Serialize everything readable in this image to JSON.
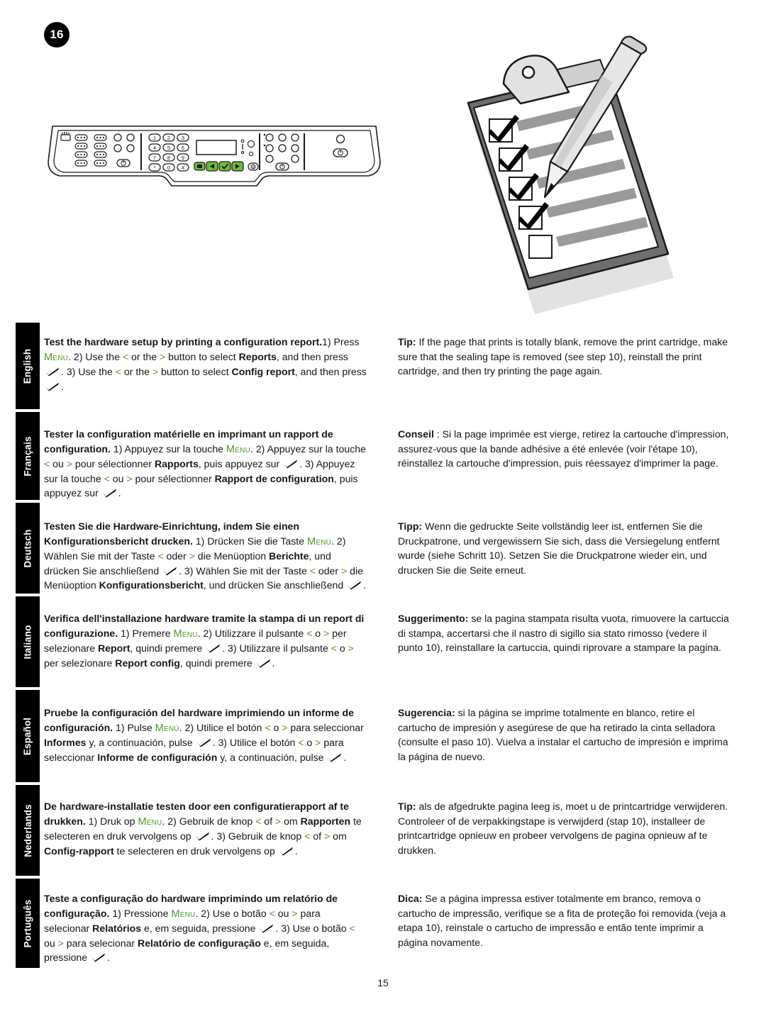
{
  "step": {
    "number": "16"
  },
  "page": {
    "number": "15"
  },
  "illustration": {
    "control_panel_name": "printer-control-panel",
    "clipboard_name": "clipboard-checklist-pencil",
    "clipboard_checked_rows": 4,
    "clipboard_unchecked_rows": 1,
    "keypad_digits": [
      "1",
      "2",
      "3",
      "4",
      "5",
      "6",
      "7",
      "8",
      "9",
      "*",
      "0",
      "#"
    ],
    "green_button_labels": [
      "menu",
      "left-arrow",
      "check",
      "right-arrow"
    ]
  },
  "languages": [
    {
      "tab": "English",
      "left": {
        "heading": "Test the hardware setup by printing a configuration report.",
        "body_1": "1) Press ",
        "menu": "Menu",
        "body_2": ". 2) Use the ",
        "lt": "<",
        "body_3": " or the ",
        "gt": ">",
        "body_4": " button to select ",
        "bold_1": "Reports",
        "body_5": ", and then press ",
        "body_6": ". 3) Use the ",
        "body_7": " or the ",
        "body_8": " button to select ",
        "bold_2": "Config report",
        "body_9": ", and then press ",
        "body_10": "."
      },
      "right": {
        "label": "Tip:",
        "text": " If the page that prints is totally blank, remove the print cartridge, make sure that the sealing tape is removed (see step 10), reinstall the print cartridge, and then try printing the page again."
      }
    },
    {
      "tab": "Français",
      "left": {
        "heading": "Tester la configuration matérielle en imprimant un rapport de configuration.",
        "body_1": "  1) Appuyez sur la touche ",
        "menu": "Menu",
        "body_2": ". 2) Appuyez sur la touche ",
        "lt": "<",
        "body_3": " ou ",
        "gt": ">",
        "body_4": " pour sélectionner ",
        "bold_1": "Rapports",
        "body_5": ", puis appuyez sur ",
        "body_6": ". 3) Appuyez sur la touche ",
        "body_7": " ou ",
        "body_8": " pour sélectionner ",
        "bold_2": "Rapport de configuration",
        "body_9": ", puis appuyez sur ",
        "body_10": "."
      },
      "right": {
        "label": "Conseil",
        "text": " : Si la page imprimée est vierge, retirez la cartouche d'impression, assurez-vous que la bande adhésive a été enlevée (voir l'étape 10), réinstallez la cartouche d'impression, puis réessayez d'imprimer la page."
      }
    },
    {
      "tab": "Deutsch",
      "left": {
        "heading": "Testen Sie die Hardware-Einrichtung, indem Sie einen Konfigurationsbericht drucken.",
        "body_1": "  1) Drücken Sie die Taste ",
        "menu": "Menü",
        "body_2": ". 2) Wählen Sie mit der Taste ",
        "lt": "<",
        "body_3": " oder ",
        "gt": ">",
        "body_4": " die Menüoption ",
        "bold_1": "Berichte",
        "body_5": ", und drücken Sie anschließend ",
        "body_6": ". 3) Wählen Sie mit der Taste ",
        "body_7": " oder ",
        "body_8": " die Menüoption ",
        "bold_2": "Konfigurationsbericht",
        "body_9": ", und drücken Sie anschließend ",
        "body_10": "."
      },
      "right": {
        "label": "Tipp:",
        "text": " Wenn die gedruckte Seite vollständig leer ist, entfernen Sie die Druckpatrone, und vergewissern Sie sich, dass die Versiegelung entfernt wurde (siehe Schritt 10). Setzen Sie die Druckpatrone wieder ein, und drucken Sie die Seite erneut."
      }
    },
    {
      "tab": "Italiano",
      "left": {
        "heading": "Verifica dell'installazione hardware tramite la stampa di un report di configurazione.",
        "body_1": "  1) Premere ",
        "menu": "Menu",
        "body_2": ". 2) Utilizzare il pulsante ",
        "lt": "<",
        "body_3": " o ",
        "gt": ">",
        "body_4": " per selezionare ",
        "bold_1": "Report",
        "body_5": ", quindi premere ",
        "body_6": ". 3) Utilizzare il pulsante ",
        "body_7": " o ",
        "body_8": " per selezionare ",
        "bold_2": "Report config",
        "body_9": ", quindi premere ",
        "body_10": "."
      },
      "right": {
        "label": "Suggerimento:",
        "text": " se la pagina stampata risulta vuota, rimuovere la cartuccia di stampa, accertarsi che il nastro di sigillo sia stato rimosso (vedere il punto 10), reinstallare la cartuccia, quindi riprovare a stampare la pagina."
      }
    },
    {
      "tab": "Español",
      "left": {
        "heading": "Pruebe la configuración del hardware imprimiendo un informe de configuración.",
        "body_1": "  1) Pulse ",
        "menu": "Menú",
        "body_2": ". 2) Utilice el botón ",
        "lt": "<",
        "body_3": " o ",
        "gt": ">",
        "body_4": " para seleccionar ",
        "bold_1": "Informes",
        "body_5": " y, a continuación, pulse ",
        "body_6": ". 3) Utilice el botón ",
        "body_7": " o ",
        "body_8": " para seleccionar ",
        "bold_2": "Informe de configuración",
        "body_9": " y, a continuación, pulse ",
        "body_10": "."
      },
      "right": {
        "label": "Sugerencia:",
        "text": " si la página se imprime totalmente en blanco, retire el cartucho de impresión y asegúrese de que ha retirado la cinta selladora (consulte el paso 10). Vuelva a instalar el cartucho de impresión e imprima la página de nuevo."
      }
    },
    {
      "tab": "Nederlands",
      "left": {
        "heading": "De hardware-installatie testen door een configuratierapport af te drukken.",
        "body_1": "  1) Druk op ",
        "menu": "Menu",
        "body_2": ". 2) Gebruik de knop ",
        "lt": "<",
        "body_3": " of ",
        "gt": ">",
        "body_4": " om ",
        "bold_1": "Rapporten",
        "body_5": " te selecteren en druk vervolgens op ",
        "body_6": ". 3) Gebruik de knop ",
        "body_7": " of ",
        "body_8": " om ",
        "bold_2": "Config-rapport",
        "body_9": " te selecteren en druk vervolgens op ",
        "body_10": "."
      },
      "right": {
        "label": "Tip:",
        "text": " als de afgedrukte pagina leeg is, moet u de printcartridge verwijderen. Controleer of de verpakkingstape is verwijderd (stap 10), installeer de printcartridge opnieuw en probeer vervolgens de pagina opnieuw af te drukken."
      }
    },
    {
      "tab": "Português",
      "left": {
        "heading": "Teste a configuração do hardware imprimindo um relatório de configuração.",
        "body_1": "  1) Pressione ",
        "menu": "Menu",
        "body_2": ". 2) Use o botão ",
        "lt": "<",
        "body_3": " ou ",
        "gt": ">",
        "body_4": " para selecionar ",
        "bold_1": "Relatórios",
        "body_5": " e, em seguida, pressione ",
        "body_6": ". 3) Use o botão ",
        "body_7": " ou ",
        "body_8": " para selecionar ",
        "bold_2": "Relatório de configuração",
        "body_9": " e, em seguida, pressione ",
        "body_10": "."
      },
      "right": {
        "label": "Dica:",
        "text": " Se a página impressa estiver totalmente em branco, remova o cartucho de impressão, verifique se a fita de proteção foi removida (veja a etapa 10), reinstale o cartucho de impressão e então tente imprimir a página novamente."
      }
    }
  ],
  "colors": {
    "accent_green": "#4c9a2a",
    "tab_background": "#000000",
    "text": "#161616"
  }
}
